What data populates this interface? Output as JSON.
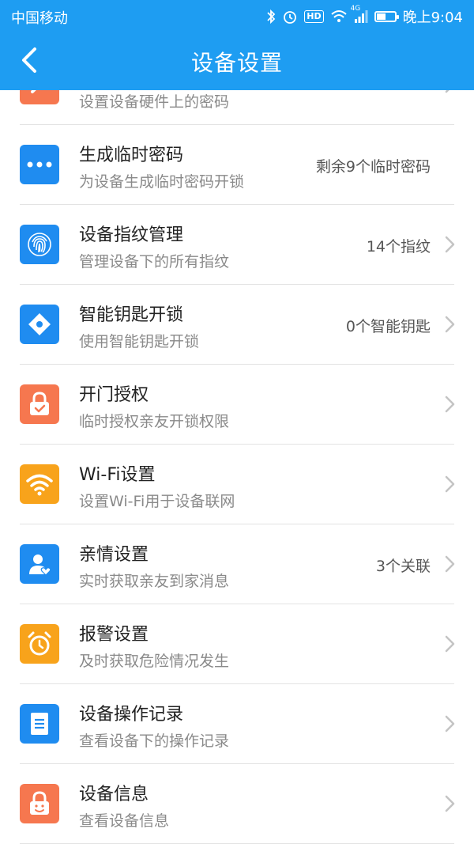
{
  "status": {
    "carrier": "中国移动",
    "network": "4G",
    "hd": "HD",
    "time": "晚上9:04",
    "battery_percent": 55
  },
  "nav": {
    "title": "设备设置"
  },
  "rows": [
    {
      "label": "",
      "sub": "设置设备硬件上的密码",
      "value": "",
      "icon": "key-icon",
      "color": "orange",
      "chevron": true
    },
    {
      "label": "生成临时密码",
      "sub": "为设备生成临时密码开锁",
      "value": "剩余9个临时密码",
      "icon": "dots-icon",
      "color": "blue",
      "chevron": false
    },
    {
      "label": "设备指纹管理",
      "sub": "管理设备下的所有指纹",
      "value": "14个指纹",
      "icon": "fingerprint-icon",
      "color": "blue",
      "chevron": true
    },
    {
      "label": "智能钥匙开锁",
      "sub": "使用智能钥匙开锁",
      "value": "0个智能钥匙",
      "icon": "diamond-icon",
      "color": "blue",
      "chevron": true
    },
    {
      "label": "开门授权",
      "sub": "临时授权亲友开锁权限",
      "value": "",
      "icon": "lock-check-icon",
      "color": "orange",
      "chevron": true
    },
    {
      "label": "Wi-Fi设置",
      "sub": "设置Wi-Fi用于设备联网",
      "value": "",
      "icon": "wifi-icon",
      "color": "yellow",
      "chevron": true
    },
    {
      "label": "亲情设置",
      "sub": "实时获取亲友到家消息",
      "value": "3个关联",
      "icon": "person-heart-icon",
      "color": "blue",
      "chevron": true
    },
    {
      "label": "报警设置",
      "sub": "及时获取危险情况发生",
      "value": "",
      "icon": "alarm-clock-icon",
      "color": "yellow",
      "chevron": true
    },
    {
      "label": "设备操作记录",
      "sub": "查看设备下的操作记录",
      "value": "",
      "icon": "document-icon",
      "color": "blue",
      "chevron": true
    },
    {
      "label": "设备信息",
      "sub": "查看设备信息",
      "value": "",
      "icon": "lock-face-icon",
      "color": "orange",
      "chevron": true
    }
  ]
}
